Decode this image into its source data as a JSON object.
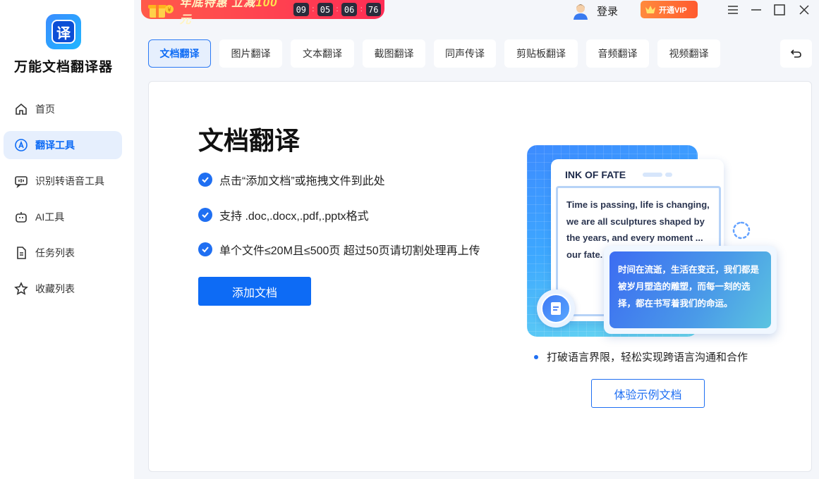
{
  "app": {
    "name": "万能文档翻译器",
    "logo_glyph": "译"
  },
  "sidebar": {
    "items": [
      {
        "label": "首页",
        "icon": "home-icon",
        "active": false
      },
      {
        "label": "翻译工具",
        "icon": "translate-icon",
        "active": true
      },
      {
        "label": "识别转语音工具",
        "icon": "voice-icon",
        "active": false
      },
      {
        "label": "AI工具",
        "icon": "robot-icon",
        "active": false
      },
      {
        "label": "任务列表",
        "icon": "task-list-icon",
        "active": false
      },
      {
        "label": "收藏列表",
        "icon": "star-icon",
        "active": false
      }
    ]
  },
  "promo": {
    "title": "年底特惠 立减",
    "amount": "100",
    "unit": "元",
    "countdown": [
      "09",
      "05",
      "06",
      "76"
    ]
  },
  "header": {
    "login": "登录",
    "vip": "开通VIP"
  },
  "tabs": [
    {
      "label": "文档翻译",
      "active": true
    },
    {
      "label": "图片翻译",
      "active": false
    },
    {
      "label": "文本翻译",
      "active": false
    },
    {
      "label": "截图翻译",
      "active": false
    },
    {
      "label": "同声传译",
      "active": false
    },
    {
      "label": "剪贴板翻译",
      "active": false
    },
    {
      "label": "音频翻译",
      "active": false
    },
    {
      "label": "视频翻译",
      "active": false
    }
  ],
  "main": {
    "title": "文档翻译",
    "features": [
      "点击“添加文档”或拖拽文件到此处",
      "支持 .doc,.docx,.pdf,.pptx格式",
      "单个文件≤20M且≤500页 超过50页请切割处理再上传"
    ],
    "add_button": "添加文档",
    "illustration": {
      "doc_title": "INK OF FATE",
      "doc_text": "Time is passing, life is changing, we are all sculptures shaped by the years, and every moment ... our fate.",
      "translation": "时间在流逝，生活在变迁，我们都是被岁月塑造的雕塑，而每一刻的选择，都在书写着我们的命运。"
    },
    "tagline": "打破语言界限，轻松实现跨语言沟通和合作",
    "sample_button": "体验示例文档"
  },
  "colors": {
    "accent": "#0d6bf5",
    "active_bg": "#e6effd",
    "promo": "#ff2d55",
    "vip": "#ff6a35"
  }
}
